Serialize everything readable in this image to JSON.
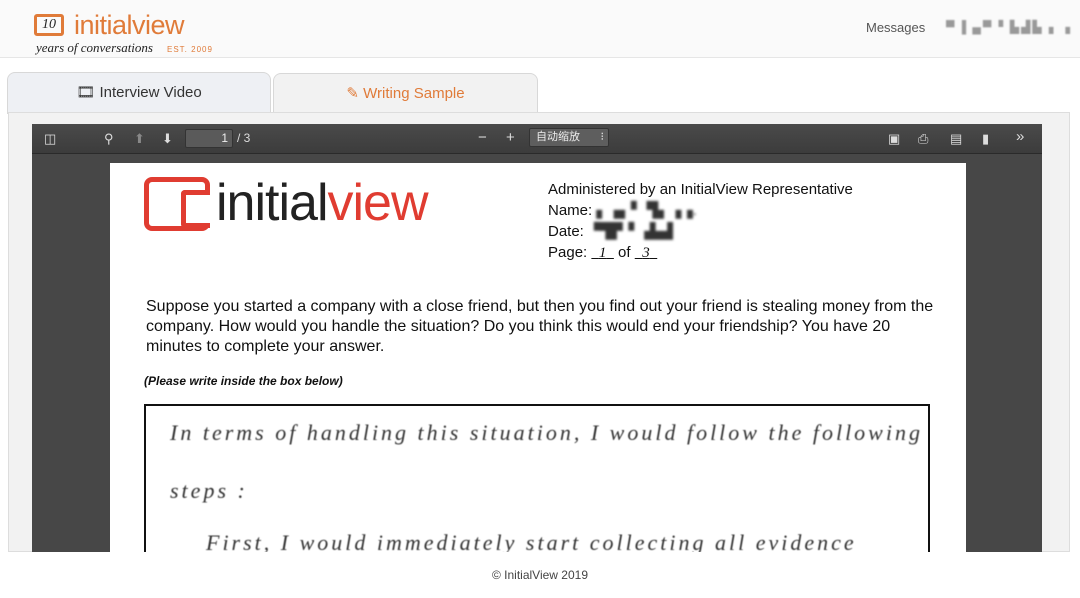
{
  "header": {
    "logo_badge": "10",
    "logo_word": "initialview",
    "logo_tagline": "years of conversations",
    "logo_est": "EST. 2009",
    "messages": "Messages",
    "user": "▀ ▌▄▀ ▘▙▟▙ ▖ ▖"
  },
  "tabs": [
    {
      "label": "Interview Video",
      "icon": "film-icon",
      "active": false
    },
    {
      "label": "Writing Sample",
      "icon": "pencil-icon",
      "active": true
    }
  ],
  "viewer": {
    "page_current": "1",
    "page_total": "/ 3",
    "zoom": "自动缩放",
    "zoom_minus": "−",
    "zoom_plus": "+"
  },
  "document": {
    "logo_word_a": "initial",
    "logo_word_b": "view",
    "administered": "Administered by an InitialView Representative",
    "name_label": "Name:",
    "name_value": "▖▗▖▘ ▜▖▗▗.",
    "date_label": "Date:",
    "date_value": "▝▜▛▝ ▗▙▟",
    "page_label": "Page:",
    "page_value": "1",
    "page_of": "of",
    "page_total": "3",
    "prompt": "Suppose you started a company with a close friend, but then you find out your friend is stealing money from the company. How would you handle the situation? Do you think this would end your friendship? You have 20 minutes to complete your answer.",
    "instruction": "(Please write inside the box below)",
    "handwriting": [
      "In terms of handling this situation, I would follow the following",
      "steps :",
      "First, I would immediately start collecting all evidence"
    ]
  },
  "footer": {
    "copyright": "© InitialView 2019"
  },
  "colors": {
    "brand_orange": "#e07b39",
    "doc_red": "#e03c31",
    "viewer_bg": "#474747"
  }
}
